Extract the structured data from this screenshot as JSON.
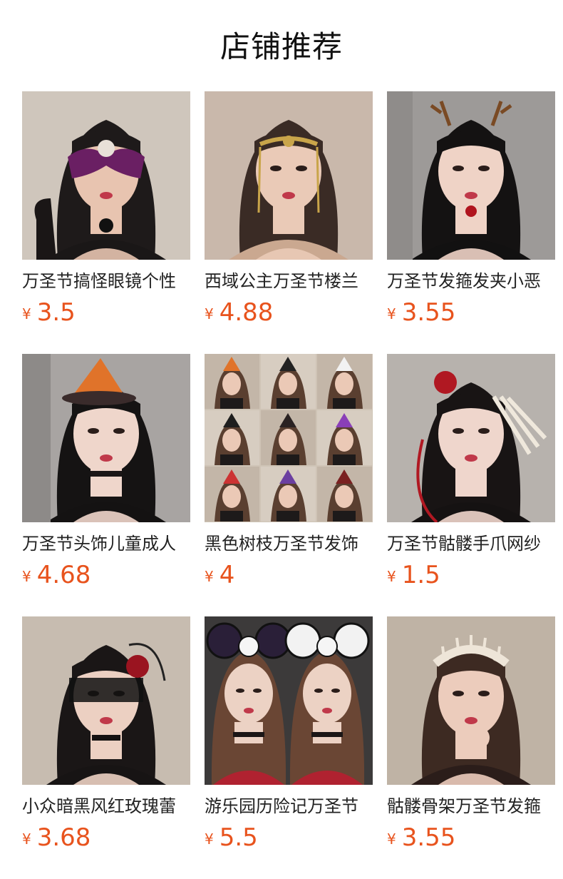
{
  "header": {
    "title": "店铺推荐"
  },
  "colors": {
    "price": "#e8531d",
    "text": "#222222"
  },
  "products": [
    {
      "name": "万圣节搞怪眼镜个性",
      "currency": "¥",
      "price": "3.5",
      "image_icon": "product-photo-masquerade-mask",
      "palette": {
        "bg": "#cfc6bc",
        "hair": "#1e1a1a",
        "skin": "#e8c4b0",
        "top": "#1a1717",
        "accent": "#6a1f63"
      }
    },
    {
      "name": "西域公主万圣节楼兰",
      "currency": "¥",
      "price": "4.88",
      "image_icon": "product-photo-gold-headpiece",
      "palette": {
        "bg": "#c9b8ab",
        "hair": "#3a2b25",
        "skin": "#eacab7",
        "top": "#caa890",
        "accent": "#c9a54a"
      }
    },
    {
      "name": "万圣节发箍发夹小恶",
      "currency": "¥",
      "price": "3.55",
      "image_icon": "product-photo-antler-headband",
      "palette": {
        "bg": "#9d9a98",
        "hair": "#141212",
        "skin": "#efd3c6",
        "top": "#121111",
        "accent": "#7a4a24"
      }
    },
    {
      "name": "万圣节头饰儿童成人",
      "currency": "¥",
      "price": "4.68",
      "image_icon": "product-photo-witch-hat",
      "palette": {
        "bg": "#a8a4a2",
        "hair": "#151313",
        "skin": "#efd6cb",
        "top": "#141212",
        "accent": "#e0732a"
      }
    },
    {
      "name": "黑色树枝万圣节发饰",
      "currency": "¥",
      "price": "4",
      "image_icon": "product-photo-collage-grid",
      "palette": {
        "bg": "#cfc4b6",
        "hair": "#5a3f30",
        "skin": "#ebc9b6",
        "top": "#222",
        "accent": "#8a3fb8"
      }
    },
    {
      "name": "万圣节骷髅手爪网纱",
      "currency": "¥",
      "price": "1.5",
      "image_icon": "product-photo-skeleton-hand",
      "palette": {
        "bg": "#b7b2ad",
        "hair": "#181414",
        "skin": "#efd6cc",
        "top": "#151212",
        "accent": "#b01822"
      }
    },
    {
      "name": "小众暗黑风红玫瑰蕾",
      "currency": "¥",
      "price": "3.68",
      "image_icon": "product-photo-lace-blindfold",
      "palette": {
        "bg": "#c7bcb0",
        "hair": "#1a1616",
        "skin": "#ecd0c2",
        "top": "#171414",
        "accent": "#9a1420"
      }
    },
    {
      "name": "游乐园历险记万圣节",
      "currency": "¥",
      "price": "5.5",
      "image_icon": "product-photo-mouse-ears",
      "palette": {
        "bg": "#3c3a3a",
        "hair": "#6a4634",
        "skin": "#ecd2c4",
        "top": "#b02230",
        "accent": "#f2f2f2"
      }
    },
    {
      "name": "骷髅骨架万圣节发箍",
      "currency": "¥",
      "price": "3.55",
      "image_icon": "product-photo-bone-headband",
      "palette": {
        "bg": "#bfb3a5",
        "hair": "#3d2a22",
        "skin": "#ecccbc",
        "top": "#2b1d1a",
        "accent": "#eee5d8"
      }
    }
  ]
}
